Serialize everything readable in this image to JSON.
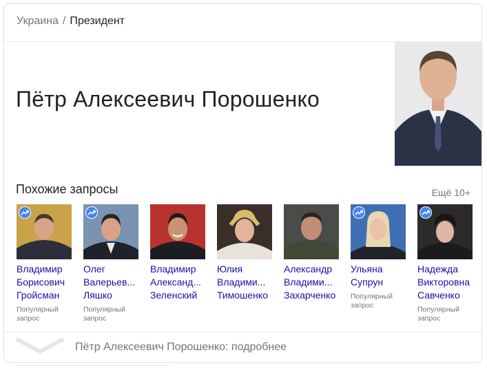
{
  "breadcrumb": {
    "country": "Украина",
    "separator": "/",
    "role": "Президент"
  },
  "entity": {
    "name": "Пётр Алексеевич Порошенко"
  },
  "related": {
    "heading": "Похожие запросы",
    "more_label": "Ещё 10+",
    "popular_label": "Популярный запрос",
    "people": [
      {
        "lines": [
          "Владимир",
          "Борисович",
          "Гройсман"
        ],
        "popular": true
      },
      {
        "lines": [
          "Олег",
          "Валерьев...",
          "Ляшко"
        ],
        "popular": true
      },
      {
        "lines": [
          "Владимир",
          "Александ...",
          "Зеленский"
        ],
        "popular": false
      },
      {
        "lines": [
          "Юлия",
          "Владими...",
          "Тимошенко"
        ],
        "popular": false
      },
      {
        "lines": [
          "Александр",
          "Владими...",
          "Захарченко"
        ],
        "popular": false
      },
      {
        "lines": [
          "Ульяна",
          "Супрун"
        ],
        "popular": true
      },
      {
        "lines": [
          "Надежда",
          "Викторовна",
          "Савченко"
        ],
        "popular": true
      }
    ]
  },
  "footer": {
    "more_link": "Пётр Алексеевич Порошенко: подробнее"
  }
}
